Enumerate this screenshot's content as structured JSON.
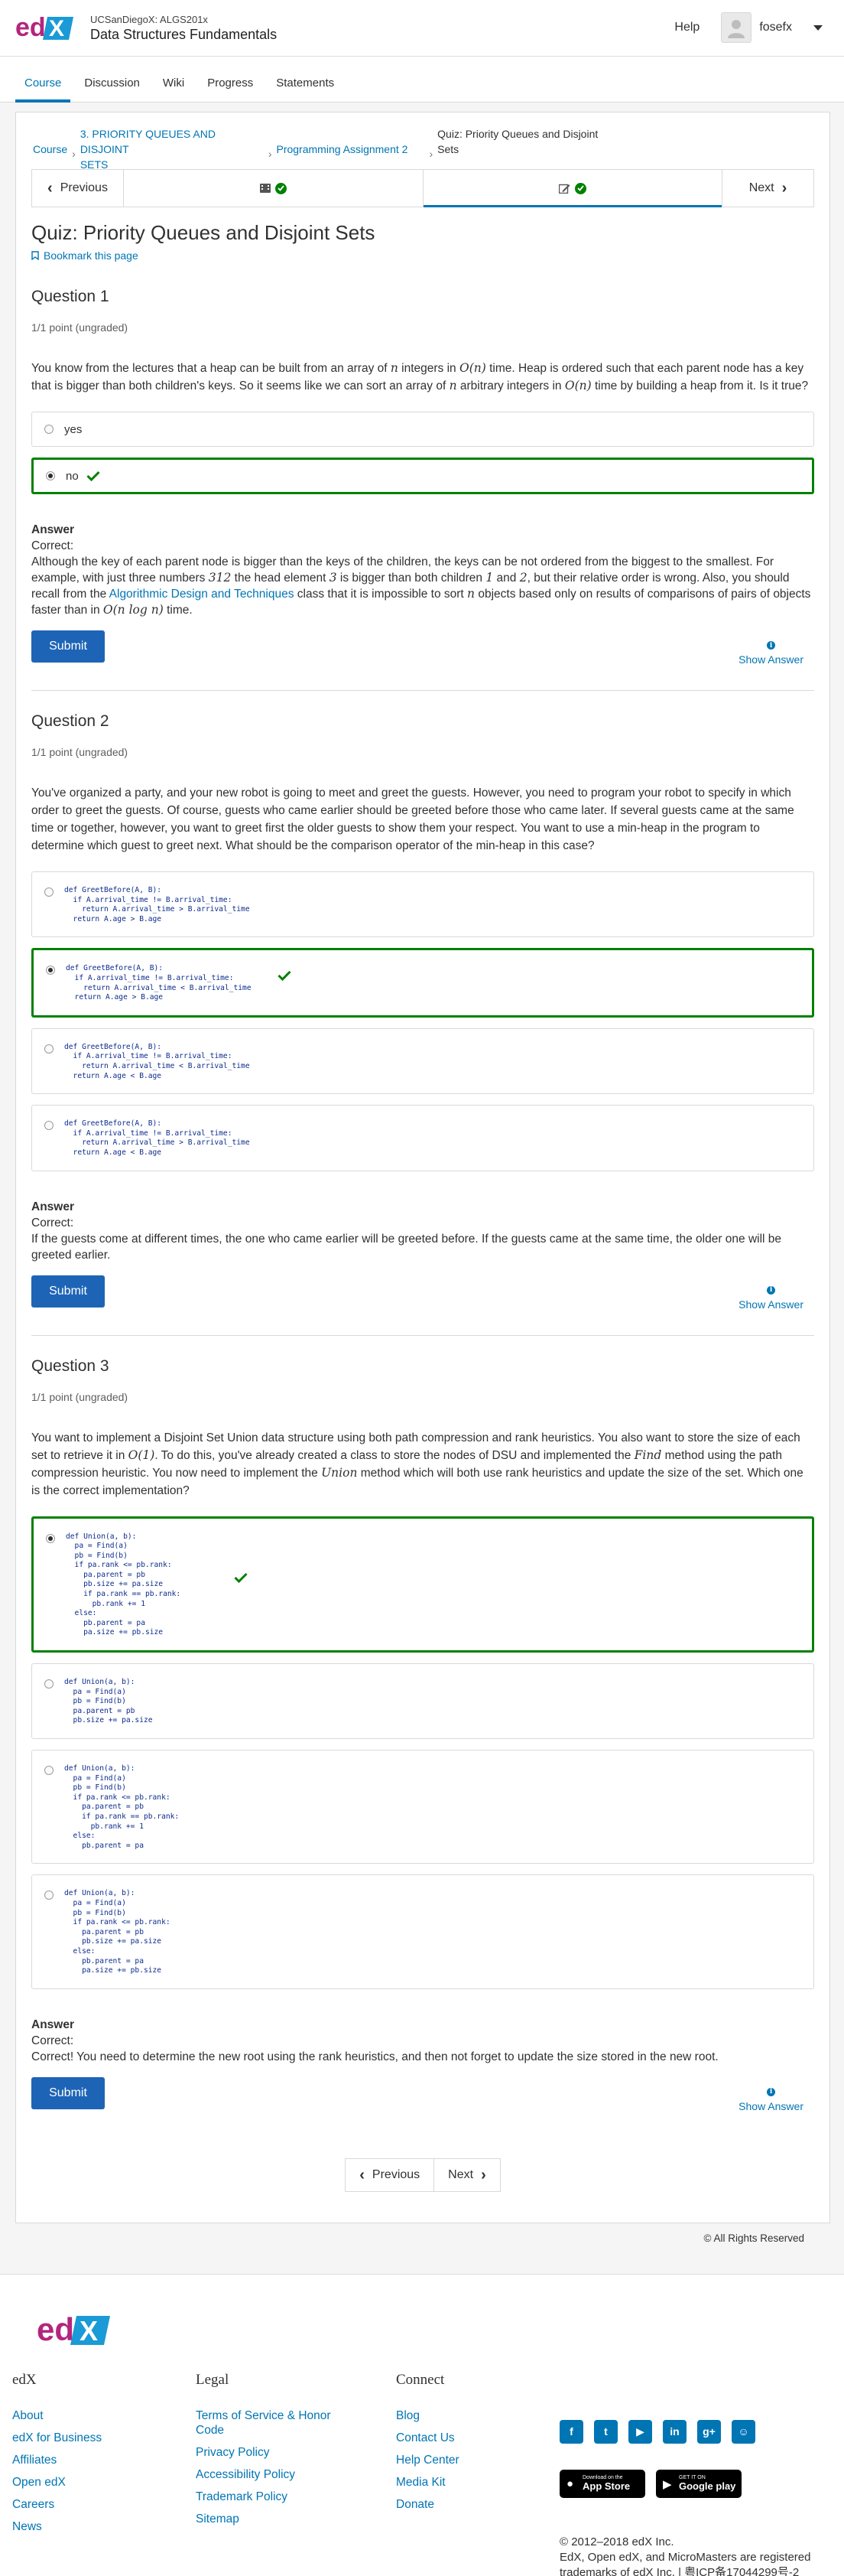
{
  "header": {
    "course_org": "UCSanDiegoX: ALGS201x",
    "course_title": "Data Structures Fundamentals",
    "help": "Help",
    "username": "fosefx"
  },
  "tabs": [
    "Course",
    "Discussion",
    "Wiki",
    "Progress",
    "Statements"
  ],
  "breadcrumb": {
    "course": "Course",
    "section_line1": "3. PRIORITY QUEUES AND DISJOINT",
    "section_line2": "SETS",
    "subsection": "Programming Assignment 2",
    "unit_line1": "Quiz: Priority Queues and Disjoint",
    "unit_line2": "Sets"
  },
  "sequence": {
    "previous": "Previous",
    "next": "Next"
  },
  "unit_title": "Quiz: Priority Queues and Disjoint Sets",
  "bookmark": "Bookmark this page",
  "problems": [
    {
      "title": "Question 1",
      "points": "1/1 point (ungraded)",
      "prompt_a": "You know from the lectures that a heap can be built from an array of ",
      "prompt_n": "n",
      "prompt_b": " integers in ",
      "prompt_On": "O(n)",
      "prompt_c": " time. Heap is ordered such that each parent node has a key that is bigger than both children's keys. So it seems like we can sort an array of ",
      "prompt_d": " arbitrary integers in ",
      "prompt_e": " time by building a heap from it. Is it true?",
      "choices": [
        "yes",
        "no"
      ],
      "answer_head": "Answer",
      "answer_correct": "Correct:",
      "answer_a": "Although the key of each parent node is bigger than the keys of the children, the keys can be not ordered from the biggest to the smallest. For example, with just three numbers ",
      "answer_312": "312",
      "answer_b": " the head element ",
      "answer_3": "3",
      "answer_c": " is bigger than both children ",
      "answer_1": "1",
      "answer_and": " and ",
      "answer_2": "2",
      "answer_d": ", but their relative order is wrong. Also, you should recall from the ",
      "answer_link": "Algorithmic Design and Techniques",
      "answer_e": " class that it is impossible to sort ",
      "answer_f": " objects based only on results of comparisons of pairs of objects faster than in ",
      "answer_nlogn": "O(n log n)",
      "answer_g": " time.",
      "submit": "Submit",
      "show_answer": "Show Answer"
    },
    {
      "title": "Question 2",
      "points": "1/1 point (ungraded)",
      "prompt": "You've organized a party, and your new robot is going to meet and greet the guests. However, you need to program your robot to specify in which order to greet the guests. Of course, guests who came earlier should be greeted before those who came later. If several guests came at the same time or together, however, you want to greet first the older guests to show them your respect. You want to use a min-heap in the program to determine which guest to greet next. What should be the comparison operator of the min-heap in this case?",
      "choices": [
        "def GreetBefore(A, B):\n  if A.arrival_time != B.arrival_time:\n    return A.arrival_time > B.arrival_time\n  return A.age > B.age",
        "def GreetBefore(A, B):\n  if A.arrival_time != B.arrival_time:\n    return A.arrival_time < B.arrival_time\n  return A.age > B.age",
        "def GreetBefore(A, B):\n  if A.arrival_time != B.arrival_time:\n    return A.arrival_time < B.arrival_time\n  return A.age < B.age",
        "def GreetBefore(A, B):\n  if A.arrival_time != B.arrival_time:\n    return A.arrival_time > B.arrival_time\n  return A.age < B.age"
      ],
      "answer_head": "Answer",
      "answer_correct": "Correct:",
      "answer_text": "If the guests come at different times, the one who came earlier will be greeted before. If the guests came at the same time, the older one will be greeted earlier.",
      "submit": "Submit",
      "show_answer": "Show Answer"
    },
    {
      "title": "Question 3",
      "points": "1/1 point (ungraded)",
      "prompt_a": "You want to implement a Disjoint Set Union data structure using both path compression and rank heuristics. You also want to store the size of each set to retrieve it in ",
      "prompt_O1": "O(1)",
      "prompt_b": ". To do this, you've already created a class to store the nodes of DSU and implemented the ",
      "prompt_find": "Find",
      "prompt_c": " method using the path compression heuristic. You now need to implement the ",
      "prompt_union": "Union",
      "prompt_d": " method which will both use rank heuristics and update the size of the set. Which one is the correct implementation?",
      "choices": [
        "def Union(a, b):\n  pa = Find(a)\n  pb = Find(b)\n  if pa.rank <= pb.rank:\n    pa.parent = pb\n    pb.size += pa.size\n    if pa.rank == pb.rank:\n      pb.rank += 1\n  else:\n    pb.parent = pa\n    pa.size += pb.size",
        "def Union(a, b):\n  pa = Find(a)\n  pb = Find(b)\n  pa.parent = pb\n  pb.size += pa.size",
        "def Union(a, b):\n  pa = Find(a)\n  pb = Find(b)\n  if pa.rank <= pb.rank:\n    pa.parent = pb\n    if pa.rank == pb.rank:\n      pb.rank += 1\n  else:\n    pb.parent = pa",
        "def Union(a, b):\n  pa = Find(a)\n  pb = Find(b)\n  if pa.rank <= pb.rank:\n    pa.parent = pb\n    pb.size += pa.size\n  else:\n    pb.parent = pa\n    pa.size += pb.size"
      ],
      "answer_head": "Answer",
      "answer_correct": "Correct:",
      "answer_text": "Correct! You need to determine the new root using the rank heuristics, and then not forget to update the size stored in the new root.",
      "submit": "Submit",
      "show_answer": "Show Answer"
    }
  ],
  "bottom_nav": {
    "previous": "Previous",
    "next": "Next"
  },
  "copyright": "© All Rights Reserved",
  "footer": {
    "edx_heading": "edX",
    "edx_links": [
      "About",
      "edX for Business",
      "Affiliates",
      "Open edX",
      "Careers",
      "News"
    ],
    "legal_heading": "Legal",
    "legal_links": [
      "Terms of Service & Honor Code",
      "Privacy Policy",
      "Accessibility Policy",
      "Trademark Policy",
      "Sitemap"
    ],
    "connect_heading": "Connect",
    "connect_links": [
      "Blog",
      "Contact Us",
      "Help Center",
      "Media Kit",
      "Donate"
    ],
    "socials": [
      "facebook-icon",
      "twitter-icon",
      "youtube-icon",
      "linkedin-icon",
      "google-plus-icon",
      "reddit-icon"
    ],
    "appstore_small": "Download on the",
    "appstore_big": "App Store",
    "googleplay_small": "GET IT ON",
    "googleplay_big": "Google play",
    "copyright_line": "© 2012–2018 edX Inc.",
    "trademark_line": "EdX, Open edX, and MicroMasters are registered trademarks of edX Inc. | 粤ICP备17044299号-2"
  },
  "colors": {
    "accent": "#0075b4",
    "correct": "#008100",
    "submit": "#1e64b6",
    "logo_magenta": "#b4257d",
    "logo_blue": "#1a9ad6"
  }
}
